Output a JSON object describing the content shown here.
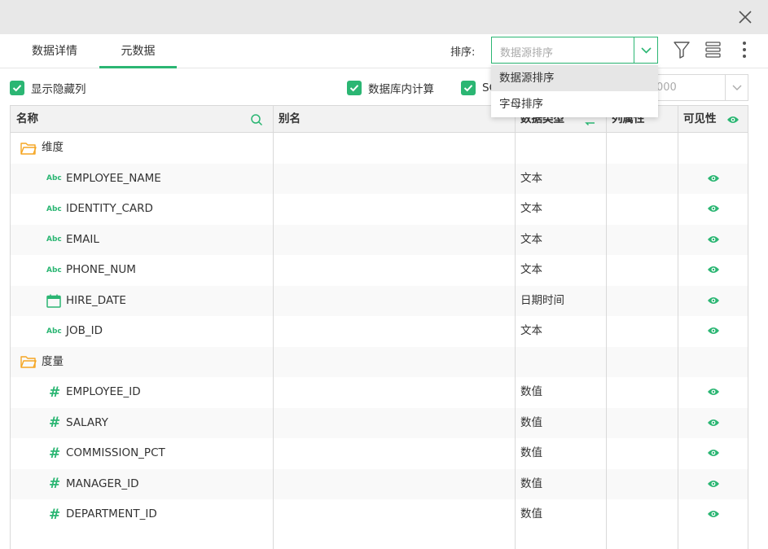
{
  "tabs": [
    {
      "label": "数据详情",
      "active": false
    },
    {
      "label": "元数据",
      "active": true
    }
  ],
  "sort": {
    "label": "排序:",
    "placeholder": "数据源排序",
    "options": [
      "数据源排序",
      "字母排序"
    ],
    "highlighted": "数据源排序"
  },
  "checks": {
    "show_hidden": "显示隐藏列",
    "db_compute": "数据库内计算",
    "sql_prefix": "SQ"
  },
  "row_limit_partial": "000",
  "columns": {
    "name": "名称",
    "alias": "别名",
    "type": "数据类型",
    "attr": "列属性",
    "visible": "可见性"
  },
  "folders": {
    "dimension": "维度",
    "measure": "度量"
  },
  "type_icons": {
    "text": "Abc",
    "number": "#"
  },
  "dimension_rows": [
    {
      "name": "EMPLOYEE_NAME",
      "type": "文本",
      "icon": "text"
    },
    {
      "name": "IDENTITY_CARD",
      "type": "文本",
      "icon": "text"
    },
    {
      "name": "EMAIL",
      "type": "文本",
      "icon": "text"
    },
    {
      "name": "PHONE_NUM",
      "type": "文本",
      "icon": "text"
    },
    {
      "name": "HIRE_DATE",
      "type": "日期时间",
      "icon": "date"
    },
    {
      "name": "JOB_ID",
      "type": "文本",
      "icon": "text"
    }
  ],
  "measure_rows": [
    {
      "name": "EMPLOYEE_ID",
      "type": "数值",
      "icon": "number"
    },
    {
      "name": "SALARY",
      "type": "数值",
      "icon": "number"
    },
    {
      "name": "COMMISSION_PCT",
      "type": "数值",
      "icon": "number"
    },
    {
      "name": "MANAGER_ID",
      "type": "数值",
      "icon": "number"
    },
    {
      "name": "DEPARTMENT_ID",
      "type": "数值",
      "icon": "number"
    }
  ],
  "colors": {
    "accent": "#2bb673",
    "folder": "#f5a623"
  }
}
